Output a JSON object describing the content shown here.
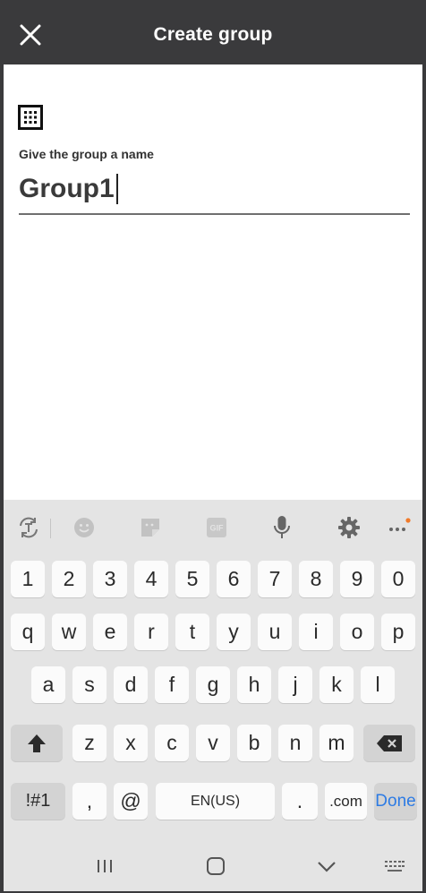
{
  "app_bar": {
    "title": "Create group",
    "close_icon": "close-icon"
  },
  "form": {
    "icon": "grid-icon",
    "label": "Give the group a name",
    "name_value": "Group1"
  },
  "keyboard": {
    "toolbar": [
      "text-recognition-icon",
      "emoji-icon",
      "sticker-icon",
      "gif-icon",
      "microphone-icon",
      "settings-icon",
      "more-icon"
    ],
    "row_numbers": [
      "1",
      "2",
      "3",
      "4",
      "5",
      "6",
      "7",
      "8",
      "9",
      "0"
    ],
    "row_q": [
      "q",
      "w",
      "e",
      "r",
      "t",
      "y",
      "u",
      "i",
      "o",
      "p"
    ],
    "row_a": [
      "a",
      "s",
      "d",
      "f",
      "g",
      "h",
      "j",
      "k",
      "l"
    ],
    "row_z": [
      "z",
      "x",
      "c",
      "v",
      "b",
      "n",
      "m"
    ],
    "bottom": {
      "symbols": "!#1",
      "comma": ",",
      "at": "@",
      "space": "EN(US)",
      "period": ".",
      "dotcom": ".com",
      "done": "Done"
    }
  },
  "colors": {
    "app_bar": "#3a3a3c",
    "keyboard_bg": "#e4e4e4",
    "done_accent": "#2d7be4",
    "more_dot": "#f07a2a"
  }
}
